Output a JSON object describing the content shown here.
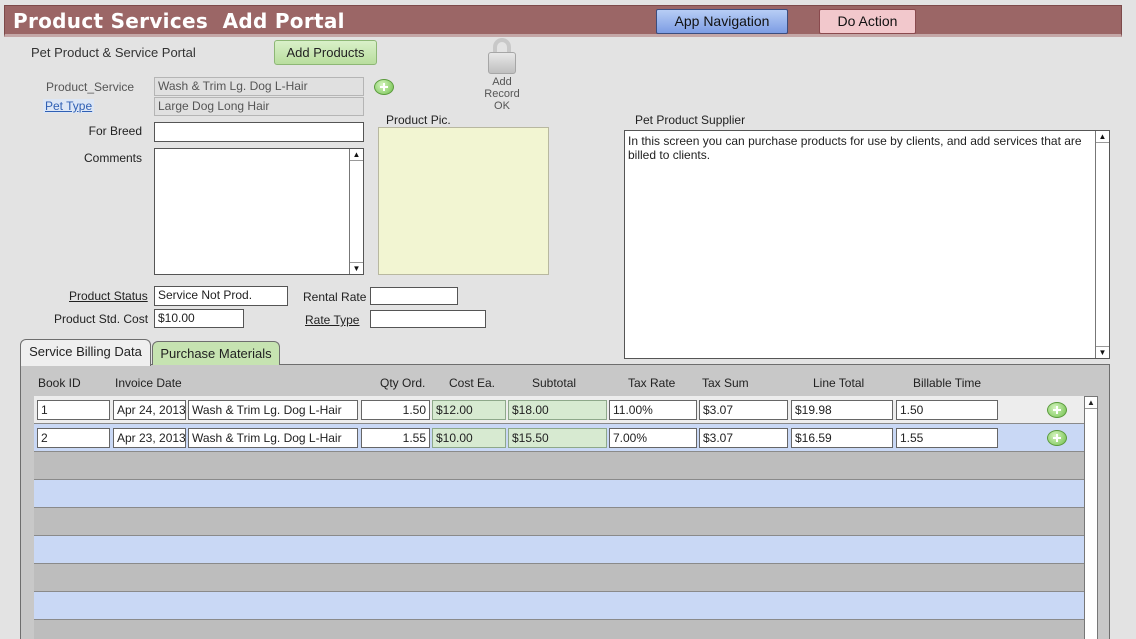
{
  "header": {
    "title": "Product Services  Add Portal",
    "app_navigation": "App Navigation",
    "do_action": "Do Action"
  },
  "portal": {
    "label": "Pet Product & Service Portal",
    "add_products": "Add Products",
    "add_record": {
      "line1": "Add",
      "line2": "Record",
      "line3": "OK"
    }
  },
  "form": {
    "product_service": {
      "label": "Product_Service",
      "value": "Wash & Trim Lg. Dog L-Hair"
    },
    "pet_type": {
      "label": "Pet Type",
      "value": "Large Dog Long Hair"
    },
    "for_breed": {
      "label": "For Breed",
      "value": ""
    },
    "comments": {
      "label": "Comments",
      "value": ""
    },
    "product_pic": {
      "label": "Product Pic."
    },
    "product_status": {
      "label": "Product Status",
      "value": "Service Not Prod."
    },
    "product_std_cost": {
      "label": "Product Std. Cost",
      "value": "$10.00"
    },
    "rental_rate": {
      "label": "Rental Rate",
      "value": ""
    },
    "rate_type": {
      "label": "Rate Type",
      "value": ""
    },
    "supplier": {
      "label": "Pet Product Supplier",
      "value": " In this screen you can purchase products for use by clients, and add services that are billed to clients."
    }
  },
  "tabs": [
    {
      "label": "Service Billing Data",
      "active": true
    },
    {
      "label": "Purchase Materials",
      "active": false
    }
  ],
  "table": {
    "columns": [
      "Book ID",
      "Invoice Date",
      "Qty Ord.",
      "Cost Ea.",
      "Subtotal",
      "Tax Rate",
      "Tax Sum",
      "Line Total",
      "Billable Time"
    ],
    "rows": [
      {
        "book_id": "1",
        "invoice_date": "Apr 24, 2013",
        "service": "Wash & Trim Lg. Dog L-Hair",
        "qty": "1.50",
        "cost": "$12.00",
        "subtotal": "$18.00",
        "tax_rate": "11.00%",
        "tax_sum": "$3.07",
        "line_total": "$19.98",
        "billable_time": "1.50"
      },
      {
        "book_id": "2",
        "invoice_date": "Apr 23, 2013",
        "service": "Wash & Trim Lg. Dog L-Hair",
        "qty": "1.55",
        "cost": "$10.00",
        "subtotal": "$15.50",
        "tax_rate": "7.00%",
        "tax_sum": "$3.07",
        "line_total": "$16.59",
        "billable_time": "1.55"
      }
    ]
  },
  "icons": {
    "add": "plus-circle-icon",
    "lock": "lock-icon",
    "scroll_up": "▲",
    "scroll_down": "▼"
  },
  "colors": {
    "title_bar": "#9b6666",
    "nav_button": "#7d9de4",
    "action_button": "#f2c8cc",
    "add_button": "#c6e3b1",
    "pic_area": "#f2f5d2",
    "row_blue": "#c9d8f5",
    "row_gray": "#bdbdbd"
  }
}
